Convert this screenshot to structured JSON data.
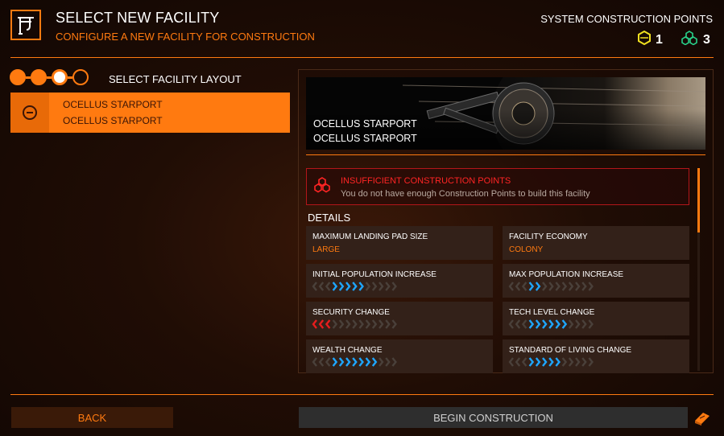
{
  "header": {
    "title": "SELECT NEW FACILITY",
    "subtitle": "CONFIGURE A NEW FACILITY FOR CONSTRUCTION",
    "icon": "construction-crane-icon",
    "construction_points": {
      "label": "SYSTEM CONSTRUCTION POINTS",
      "tier2": {
        "value": "1",
        "color": "#f0e020",
        "icon": "hex-single-icon"
      },
      "tier3": {
        "value": "3",
        "color": "#28d08a",
        "icon": "hex-cluster-icon"
      }
    }
  },
  "steps": {
    "total": 4,
    "completed": 2,
    "current": 3,
    "label": "SELECT FACILITY LAYOUT"
  },
  "facility_list": [
    {
      "line1": "OCELLUS STARPORT",
      "line2": "OCELLUS STARPORT",
      "selected": true
    }
  ],
  "preview": {
    "name1": "OCELLUS STARPORT",
    "name2": "OCELLUS STARPORT"
  },
  "warning": {
    "title": "INSUFFICIENT CONSTRUCTION POINTS",
    "body": "You do not have enough Construction Points to build this facility"
  },
  "details": {
    "heading": "DETAILS",
    "landing_pad": {
      "label": "MAXIMUM LANDING PAD SIZE",
      "value": "LARGE"
    },
    "economy": {
      "label": "FACILITY ECONOMY",
      "value": "COLONY"
    },
    "initial_population": {
      "label": "INITIAL POPULATION INCREASE",
      "positive": 5,
      "negative": 0
    },
    "max_population": {
      "label": "MAX POPULATION INCREASE",
      "positive": 2,
      "negative": 0
    },
    "security": {
      "label": "SECURITY CHANGE",
      "positive": 0,
      "negative": 3
    },
    "tech_level": {
      "label": "TECH LEVEL CHANGE",
      "positive": 6,
      "negative": 0
    },
    "wealth": {
      "label": "WEALTH CHANGE",
      "positive": 7,
      "negative": 0
    },
    "standard_of_living": {
      "label": "STANDARD OF LIVING CHANGE",
      "positive": 5,
      "negative": 0
    }
  },
  "footer": {
    "back_label": "BACK",
    "begin_label": "BEGIN CONSTRUCTION"
  },
  "colors": {
    "accent": "#ff7a10",
    "positive": "#1ea6ff",
    "negative": "#e51d1d",
    "inactive": "#4a403a"
  }
}
